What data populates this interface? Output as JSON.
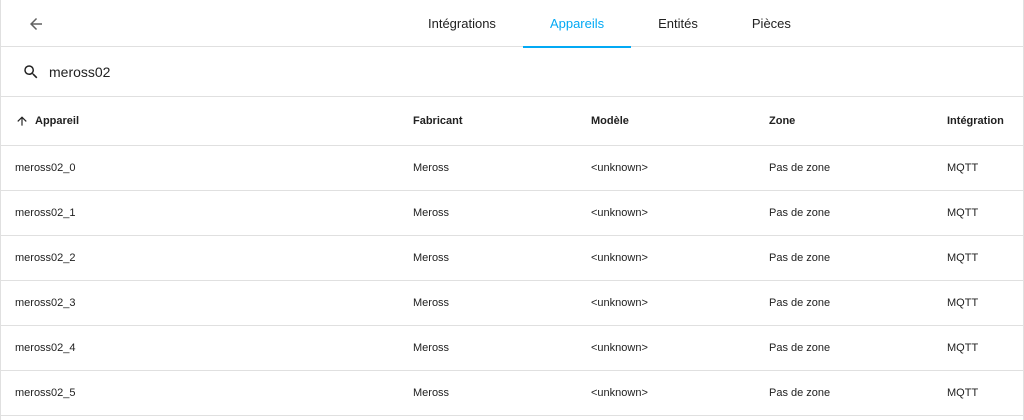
{
  "header": {
    "back_icon": "arrow-left-icon",
    "tabs": [
      {
        "label": "Intégrations",
        "active": false
      },
      {
        "label": "Appareils",
        "active": true
      },
      {
        "label": "Entités",
        "active": false
      },
      {
        "label": "Pièces",
        "active": false
      }
    ],
    "accent_color": "#03a9f4"
  },
  "search": {
    "icon": "search-icon",
    "value": "meross02"
  },
  "table": {
    "sort_icon": "arrow-up-icon",
    "columns": [
      "Appareil",
      "Fabricant",
      "Modèle",
      "Zone",
      "Intégration"
    ],
    "rows": [
      [
        "meross02_0",
        "Meross",
        "<unknown>",
        "Pas de zone",
        "MQTT"
      ],
      [
        "meross02_1",
        "Meross",
        "<unknown>",
        "Pas de zone",
        "MQTT"
      ],
      [
        "meross02_2",
        "Meross",
        "<unknown>",
        "Pas de zone",
        "MQTT"
      ],
      [
        "meross02_3",
        "Meross",
        "<unknown>",
        "Pas de zone",
        "MQTT"
      ],
      [
        "meross02_4",
        "Meross",
        "<unknown>",
        "Pas de zone",
        "MQTT"
      ],
      [
        "meross02_5",
        "Meross",
        "<unknown>",
        "Pas de zone",
        "MQTT"
      ]
    ]
  }
}
